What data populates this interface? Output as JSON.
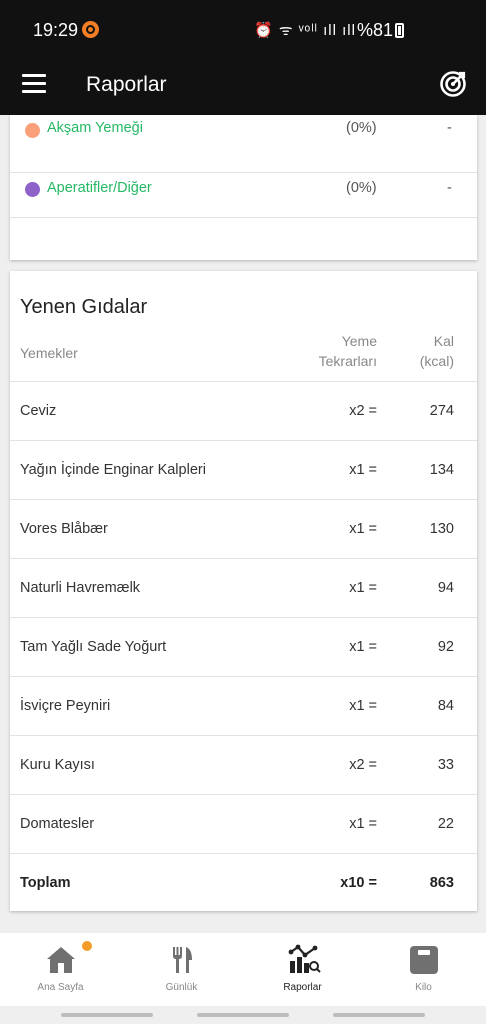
{
  "status_bar": {
    "time": "19:29",
    "icons_text": "⏰ ᯤ ᵛᵒˡˡ ıll ıll",
    "battery": "%81"
  },
  "app_bar": {
    "title": "Raporlar",
    "menu_icon": "hamburger-menu-icon",
    "goal_icon": "target-icon"
  },
  "meal_summary": {
    "rows": [
      {
        "name": "Akşam Yemeği",
        "percent": "(0%)",
        "value": "-",
        "color": "#f9a07a"
      },
      {
        "name": "Aperatifler/Diğer",
        "percent": "(0%)",
        "value": "-",
        "color": "#8e62c9"
      }
    ]
  },
  "eaten_foods": {
    "title": "Yenen Gıdalar",
    "columns": {
      "food": "Yemekler",
      "times_line1": "Yeme",
      "times_line2": "Tekrarları",
      "kcal_line1": "Kal",
      "kcal_line2": "(kcal)"
    },
    "rows": [
      {
        "name": "Ceviz",
        "times": "x2 =",
        "kcal": "274"
      },
      {
        "name": "Yağın İçinde Enginar Kalpleri",
        "times": "x1 =",
        "kcal": "134"
      },
      {
        "name": "Vores Blåbær",
        "times": "x1 =",
        "kcal": "130"
      },
      {
        "name": "Naturli Havremælk",
        "times": "x1 =",
        "kcal": "94"
      },
      {
        "name": "Tam Yağlı Sade Yoğurt",
        "times": "x1 =",
        "kcal": "92"
      },
      {
        "name": "İsviçre Peyniri",
        "times": "x1 =",
        "kcal": "84"
      },
      {
        "name": "Kuru Kayısı",
        "times": "x2 =",
        "kcal": "33"
      },
      {
        "name": "Domatesler",
        "times": "x1 =",
        "kcal": "22"
      }
    ],
    "total": {
      "name": "Toplam",
      "times": "x10 =",
      "kcal": "863"
    }
  },
  "bottom_nav": {
    "items": [
      {
        "label": "Ana Sayfa",
        "icon": "home-icon",
        "active": false,
        "badge": true
      },
      {
        "label": "Günlük",
        "icon": "fork-knife-icon",
        "active": false
      },
      {
        "label": "Raporlar",
        "icon": "chart-icon",
        "active": true
      },
      {
        "label": "Kilo",
        "icon": "scale-icon",
        "active": false
      }
    ]
  },
  "colors": {
    "accent_green": "#26b864",
    "appbar_bg": "#111111",
    "badge_orange": "#f39c2a"
  }
}
